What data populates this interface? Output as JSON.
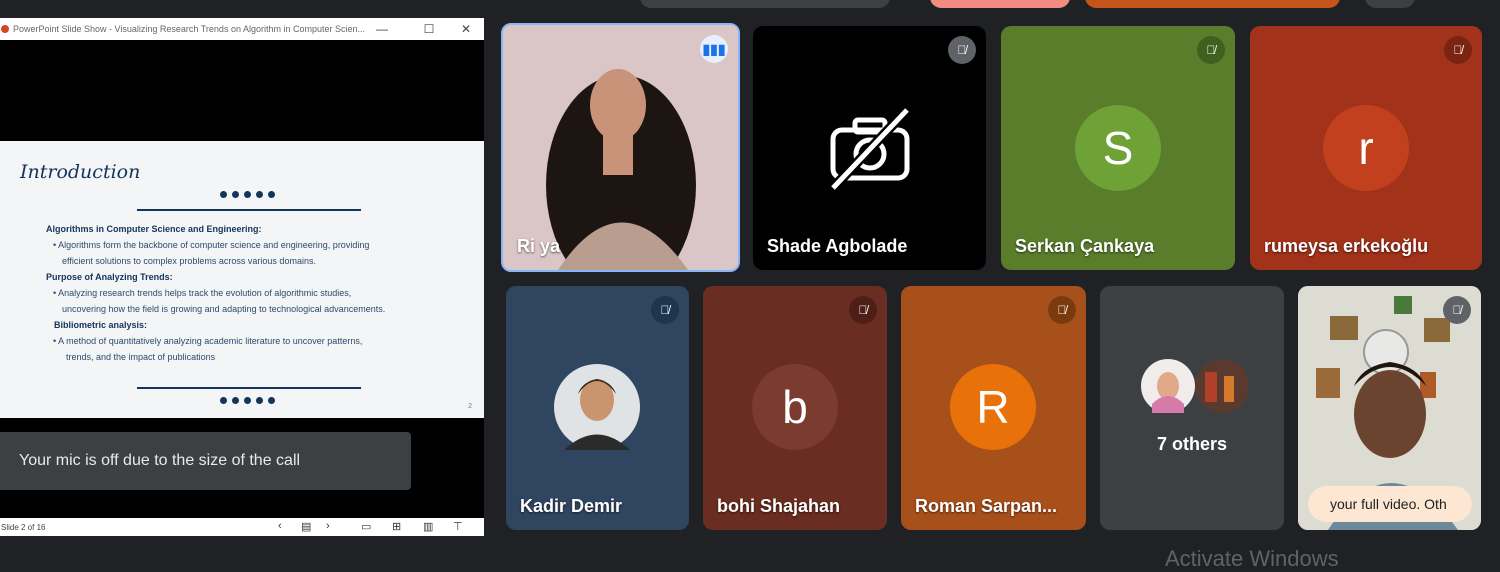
{
  "ppt": {
    "window_title": "PowerPoint Slide Show  -  Visualizing Research Trends on Algorithm in Computer Scien...",
    "slide": {
      "heading": "Introduction",
      "lines": [
        {
          "text": "Algorithms in Computer Science and Engineering:",
          "bold": true
        },
        {
          "text": "•   Algorithms form the backbone of computer science and engineering, providing",
          "bold": false
        },
        {
          "text": "efficient solutions to complex problems across various domains.",
          "bold": false
        },
        {
          "text": "Purpose of Analyzing Trends:",
          "bold": true
        },
        {
          "text": "•   Analyzing research trends helps track the evolution of algorithmic studies,",
          "bold": false
        },
        {
          "text": "uncovering how the field is growing and adapting to technological advancements.",
          "bold": false
        },
        {
          "text": "Bibliometric analysis:",
          "bold": true
        },
        {
          "text": "•      A method of quantitatively analyzing academic literature to uncover patterns,",
          "bold": false
        },
        {
          "text": "trends, and the impact of publications",
          "bold": false
        }
      ],
      "page_number": "2"
    },
    "status": "Slide 2 of 16"
  },
  "mic_toast": "Your mic is off due to the size of the call",
  "participants": [
    {
      "name": "Ri ya"
    },
    {
      "name": "Shade Agbolade"
    },
    {
      "name": "Serkan Çankaya",
      "initial": "S"
    },
    {
      "name": "rumeysa erkekoğlu",
      "initial": "r"
    },
    {
      "name": "Kadir Demir"
    },
    {
      "name": "bohi Shajahan",
      "initial": "b"
    },
    {
      "name": "Roman Sarpan...",
      "initial": "R"
    },
    {
      "name": "7 others"
    },
    {
      "toast": "your full video. Oth"
    }
  ],
  "watermark": "Activate Windows",
  "colors": {
    "background": "#202124",
    "speaking_border": "#8ab4f8",
    "serkan_avatar": "#6ea236",
    "rumeysa_avatar": "#c2401e",
    "bohi_avatar": "#7b3b2e",
    "roman_avatar": "#e8710a"
  }
}
